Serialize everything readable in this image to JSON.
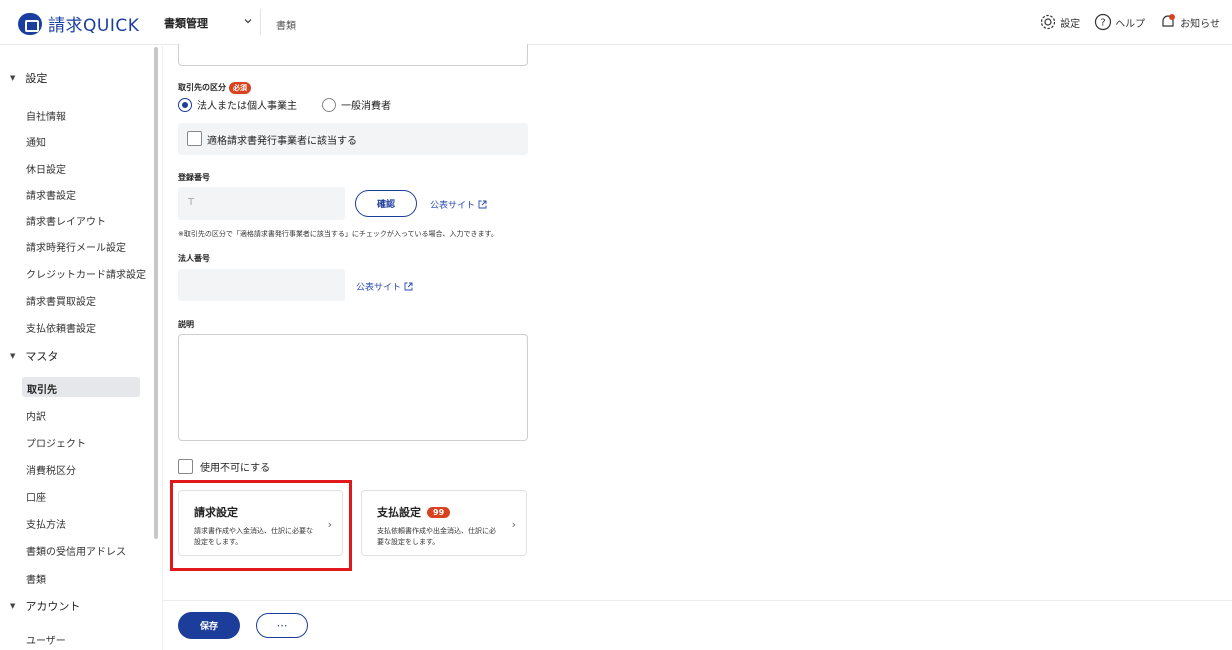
{
  "header": {
    "logo_text": "請求QUICK",
    "product_menu_label": "書類管理",
    "breadcrumb": "書類",
    "settings_label": "設定",
    "help_label": "ヘルプ",
    "notifications_label": "お知らせ"
  },
  "sidebar": {
    "sections": [
      {
        "label": "設定",
        "items": [
          "自社情報",
          "通知",
          "休日設定",
          "請求書設定",
          "請求書レイアウト",
          "請求時発行メール設定",
          "クレジットカード請求設定",
          "請求書買取設定",
          "支払依頼書設定"
        ]
      },
      {
        "label": "マスタ",
        "items": [
          "取引先",
          "内訳",
          "プロジェクト",
          "消費税区分",
          "口座",
          "支払方法",
          "書類の受信用アドレス",
          "書類"
        ]
      },
      {
        "label": "アカウント",
        "items": [
          "ユーザー"
        ]
      }
    ],
    "active_item": "取引先"
  },
  "form": {
    "partner_type_label": "取引先の区分",
    "required_badge": "必須",
    "radio_corporate": "法人または個人事業主",
    "radio_consumer": "一般消費者",
    "qualified_issuer_label": "適格請求書発行事業者に該当する",
    "registration_label": "登録番号",
    "registration_placeholder": "T",
    "confirm_button": "確認",
    "public_site_link": "公表サイト",
    "registration_note": "※取引先の区分で「適格請求書発行事業者に該当する」にチェックが入っている場合、入力できます。",
    "corporate_number_label": "法人番号",
    "public_site_link_2": "公表サイト",
    "description_label": "説明",
    "disable_label": "使用不可にする"
  },
  "cards": {
    "billing": {
      "title": "請求設定",
      "description": "請求書作成や入金消込、仕訳に必要な設定をします。"
    },
    "payment": {
      "title": "支払設定",
      "badge": "99",
      "description": "支払依頼書作成や出金消込、仕訳に必要な設定をします。"
    }
  },
  "footer": {
    "save_label": "保存",
    "more_label": "⋯"
  },
  "colors": {
    "brand": "#1d3d9a",
    "badge": "#d9421f",
    "highlight": "#e0181b"
  }
}
